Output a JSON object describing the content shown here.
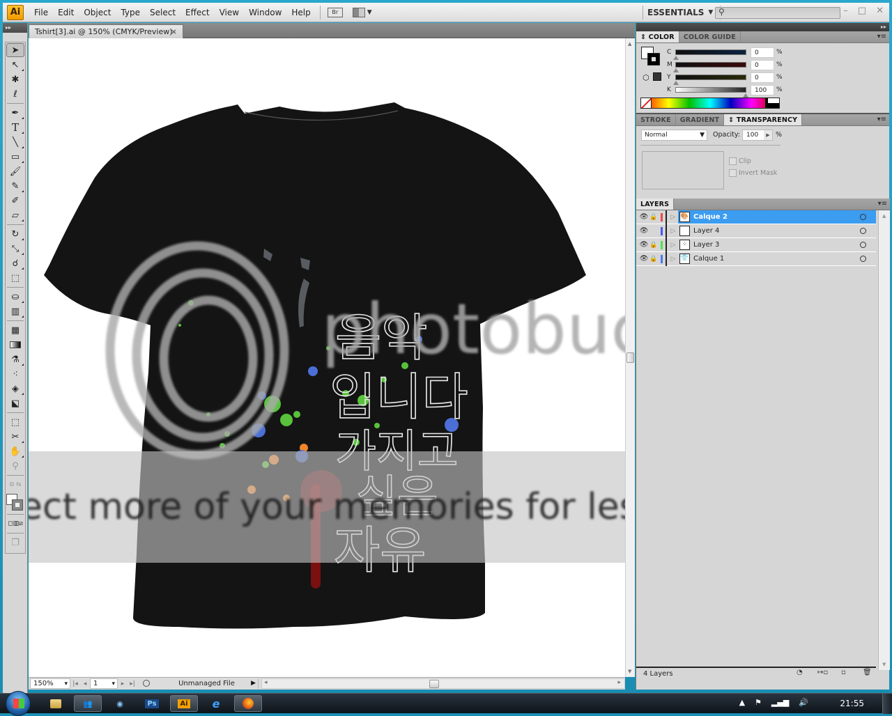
{
  "app": {
    "logo": "Ai",
    "menu": [
      "File",
      "Edit",
      "Object",
      "Type",
      "Select",
      "Effect",
      "View",
      "Window",
      "Help"
    ],
    "bridge_button": "Br",
    "workspace": "ESSENTIALS",
    "search_placeholder": "",
    "window_controls": [
      "minimize",
      "maximize",
      "close"
    ]
  },
  "document_tab": {
    "title": "Tshirt[3].ai @ 150% (CMYK/Preview)",
    "close": "×"
  },
  "tools": [
    "selection-tool",
    "direct-selection-tool",
    "magic-wand-tool",
    "lasso-tool",
    "pen-tool",
    "type-tool",
    "line-segment-tool",
    "rectangle-tool",
    "paintbrush-tool",
    "pencil-tool",
    "blob-brush-tool",
    "eraser-tool",
    "rotate-tool",
    "scale-tool",
    "warp-tool",
    "free-transform-tool",
    "symbol-sprayer-tool",
    "column-graph-tool",
    "mesh-tool",
    "gradient-tool",
    "eyedropper-tool",
    "blend-tool",
    "live-paint-bucket-tool",
    "live-paint-selection-tool",
    "artboard-tool",
    "slice-tool",
    "hand-tool",
    "zoom-tool"
  ],
  "canvas": {
    "artwork": "black t-shirt with paint splatter and Korean outline text",
    "korean_text": [
      "음악",
      "입니다",
      "가지고",
      "싶은",
      "자유"
    ],
    "watermark": {
      "logo_text": "photobucket",
      "banner_text": "Protect more of your memories for less!"
    }
  },
  "status": {
    "zoom": "150%",
    "page": "1",
    "file_status": "Unmanaged File"
  },
  "color_panel": {
    "tabs": [
      "COLOR",
      "COLOR GUIDE"
    ],
    "active_tab": "COLOR",
    "channels": [
      {
        "label": "C",
        "value": "0",
        "unit": "%"
      },
      {
        "label": "M",
        "value": "0",
        "unit": "%"
      },
      {
        "label": "Y",
        "value": "0",
        "unit": "%"
      },
      {
        "label": "K",
        "value": "100",
        "unit": "%"
      }
    ]
  },
  "transparency_panel": {
    "tabs": [
      "STROKE",
      "GRADIENT",
      "TRANSPARENCY"
    ],
    "active_tab": "TRANSPARENCY",
    "blend_mode": "Normal",
    "opacity_label": "Opacity:",
    "opacity": "100",
    "opacity_unit": "%",
    "clip_label": "Clip",
    "invert_mask_label": "Invert Mask"
  },
  "layers_panel": {
    "title": "LAYERS",
    "layers": [
      {
        "name": "Calque 2",
        "visible": true,
        "locked": true,
        "color": "#e84a4a",
        "selected": true,
        "thumb": "🎨"
      },
      {
        "name": "Layer 4",
        "visible": true,
        "locked": false,
        "color": "#4a5af0",
        "selected": false,
        "thumb": ""
      },
      {
        "name": "Layer 3",
        "visible": true,
        "locked": true,
        "color": "#4ae84a",
        "selected": false,
        "thumb": "⁘"
      },
      {
        "name": "Calque 1",
        "visible": true,
        "locked": true,
        "color": "#4a7af0",
        "selected": false,
        "thumb": "👕"
      }
    ],
    "count_label": "4 Layers"
  },
  "taskbar": {
    "items": [
      "windows-explorer",
      "messenger",
      "itunes",
      "photoshop",
      "illustrator",
      "internet-explorer",
      "firefox"
    ],
    "labels": {
      "photoshop": "Ps",
      "illustrator": "Ai"
    },
    "clock": "21:55"
  }
}
